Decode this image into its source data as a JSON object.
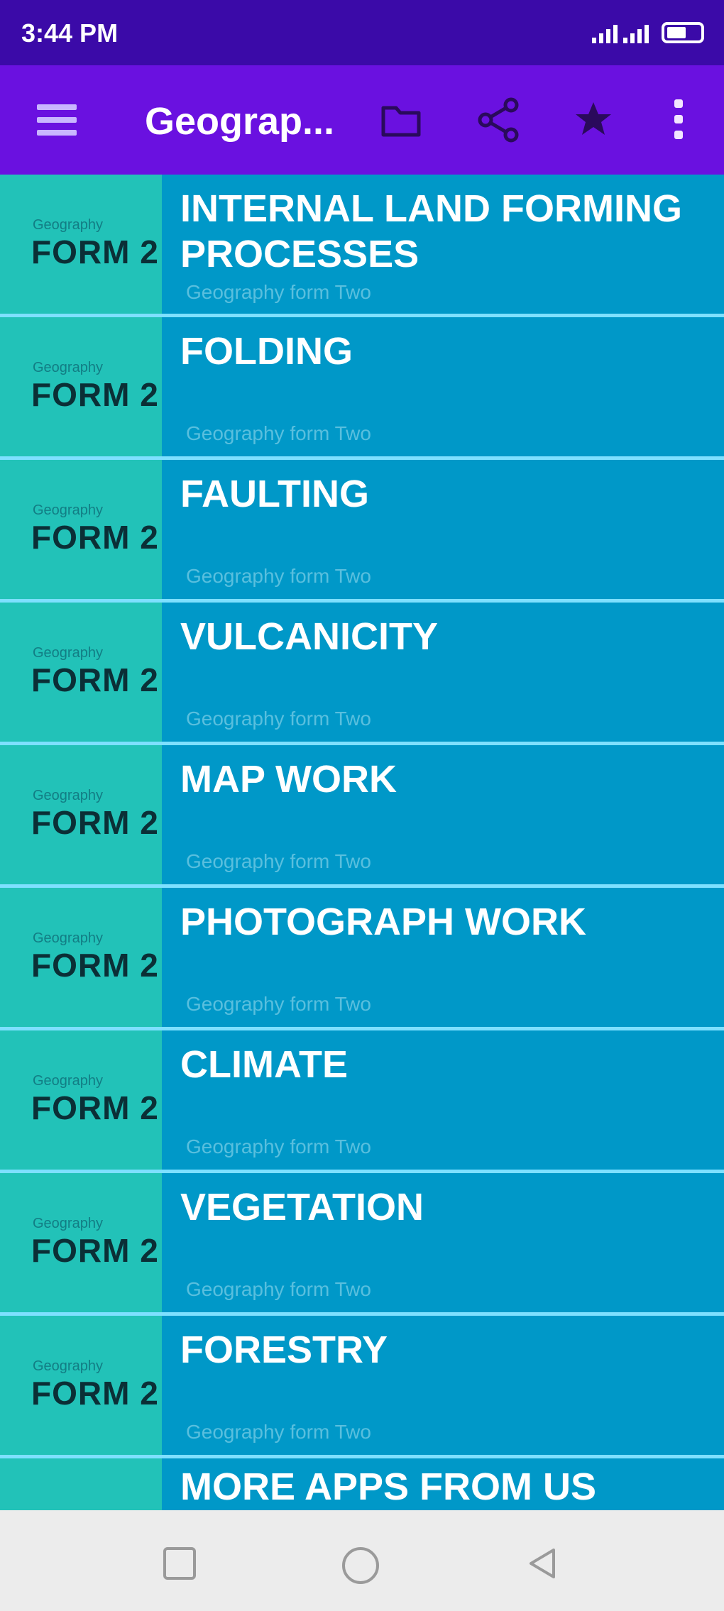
{
  "status_bar": {
    "time": "3:44 PM"
  },
  "toolbar": {
    "title": "Geograp...",
    "icons": [
      "menu-icon",
      "folder-icon",
      "share-icon",
      "star-icon",
      "more-vert-icon"
    ],
    "colors": {
      "toolbar_bg": "#6a11e0",
      "status_bg": "#3b0aa8"
    }
  },
  "list": {
    "colors": {
      "row_bg": "#0098c8",
      "thumb_bg": "#22c2b8",
      "separator": "#7ee0ff"
    },
    "thumb_small": "Geography",
    "thumb_big": "FORM 2",
    "items": [
      {
        "title": "INTERNAL LAND FORMING PROCESSES",
        "subtitle": "Geography form Two"
      },
      {
        "title": "FOLDING",
        "subtitle": "Geography form Two"
      },
      {
        "title": "FAULTING",
        "subtitle": "Geography form Two"
      },
      {
        "title": "VULCANICITY",
        "subtitle": "Geography form Two"
      },
      {
        "title": "MAP WORK",
        "subtitle": "Geography form Two"
      },
      {
        "title": "PHOTOGRAPH WORK",
        "subtitle": "Geography form Two"
      },
      {
        "title": "CLIMATE",
        "subtitle": "Geography form Two"
      },
      {
        "title": "VEGETATION",
        "subtitle": "Geography form Two"
      },
      {
        "title": "FORESTRY",
        "subtitle": "Geography form Two"
      },
      {
        "title": "MORE APPS FROM US",
        "subtitle": ""
      }
    ]
  },
  "navbar": {
    "icons": [
      "recents-square-icon",
      "home-circle-icon",
      "back-triangle-icon"
    ]
  }
}
